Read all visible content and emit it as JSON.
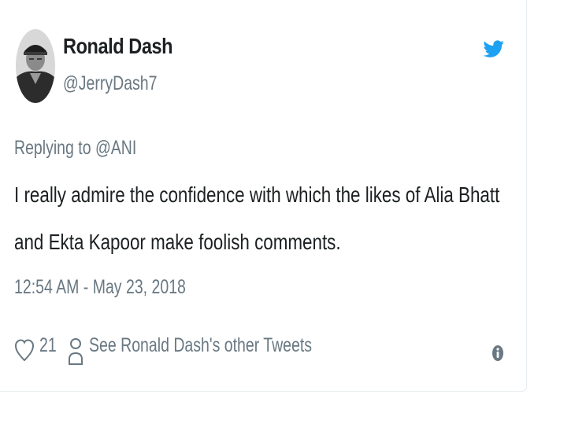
{
  "tweet": {
    "author_name": "Ronald Dash",
    "author_handle": "@JerryDash7",
    "replying_to_prefix": "Replying to ",
    "replying_to_mention": "@ANI",
    "text_line1": "I really admire the confidence with which the likes of Alia Bhatt",
    "text_line2": "and Ekta Kapoor make foolish comments.",
    "timestamp": "12:54 AM - May 23, 2018",
    "like_count": "21",
    "see_other_tweets": "See Ronald Dash's other Tweets"
  },
  "icons": {
    "brand": "twitter-bird-icon",
    "like": "heart-icon",
    "profile": "person-icon",
    "info": "info-icon"
  },
  "colors": {
    "twitter_blue": "#1da1f2",
    "text_primary": "#1c2022",
    "text_secondary": "#697882",
    "border": "#e6ecf0"
  }
}
